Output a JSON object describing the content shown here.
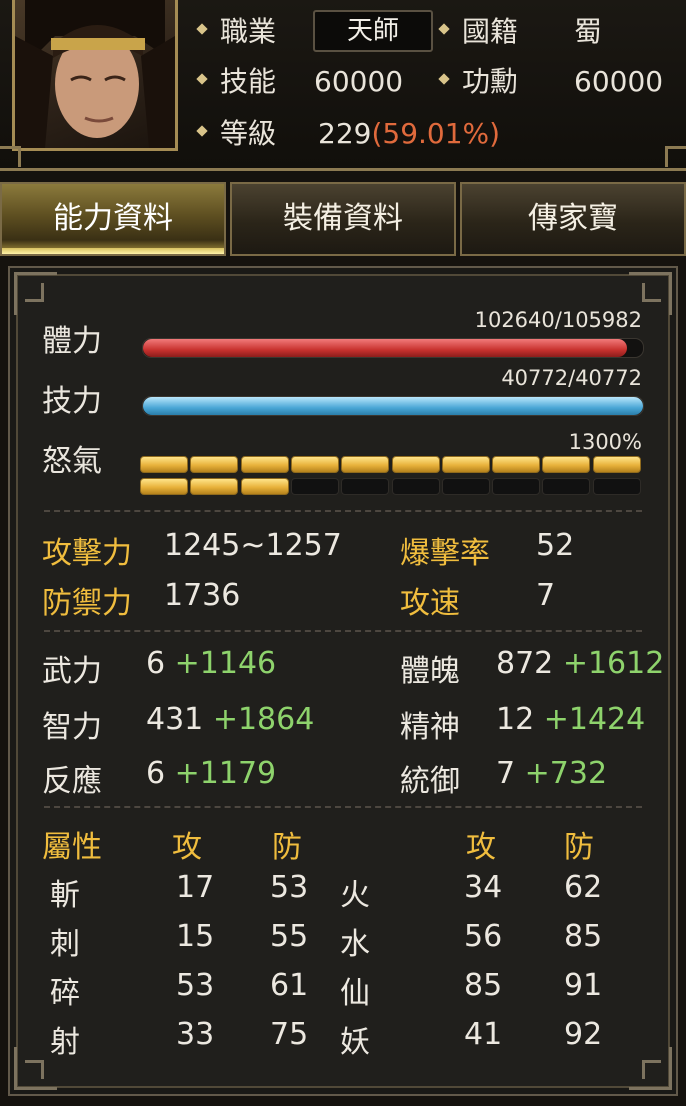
{
  "header": {
    "class_label": "職業",
    "class_value": "天師",
    "nation_label": "國籍",
    "nation_value": "蜀",
    "skill_label": "技能",
    "skill_value": "60000",
    "merit_label": "功勳",
    "merit_value": "60000",
    "level_label": "等級",
    "level_value": "229",
    "level_pct": "(59.01%)"
  },
  "tabs": [
    "能力資料",
    "裝備資料",
    "傳家寶"
  ],
  "active_tab": 0,
  "vitals": {
    "hp_label": "體力",
    "hp_text": "102640/105982",
    "hp_fraction": 0.9685,
    "mp_label": "技力",
    "mp_text": "40772/40772",
    "mp_fraction": 1.0,
    "rage_label": "怒氣",
    "rage_text": "1300%",
    "rage_filled": 13,
    "rage_total": 20
  },
  "combat": {
    "atk_label": "攻擊力",
    "atk_value": "1245~1257",
    "crit_label": "爆擊率",
    "crit_value": "52",
    "def_label": "防禦力",
    "def_value": "1736",
    "speed_label": "攻速",
    "speed_value": "7"
  },
  "attributes": [
    {
      "label": "武力",
      "base": "6",
      "bonus": "+1146"
    },
    {
      "label": "體魄",
      "base": "872",
      "bonus": "+1612"
    },
    {
      "label": "智力",
      "base": "431",
      "bonus": "+1864"
    },
    {
      "label": "精神",
      "base": "12",
      "bonus": "+1424"
    },
    {
      "label": "反應",
      "base": "6",
      "bonus": "+1179"
    },
    {
      "label": "統御",
      "base": "7",
      "bonus": "+732"
    }
  ],
  "elements": {
    "header": {
      "title": "屬性",
      "atk": "攻",
      "def": "防",
      "atk2": "攻",
      "def2": "防"
    },
    "rows": [
      {
        "a": "斬",
        "a_atk": "17",
        "a_def": "53",
        "b": "火",
        "b_atk": "34",
        "b_def": "62"
      },
      {
        "a": "刺",
        "a_atk": "15",
        "a_def": "55",
        "b": "水",
        "b_atk": "56",
        "b_def": "85"
      },
      {
        "a": "碎",
        "a_atk": "53",
        "a_def": "61",
        "b": "仙",
        "b_atk": "85",
        "b_def": "91"
      },
      {
        "a": "射",
        "a_atk": "33",
        "a_def": "75",
        "b": "妖",
        "b_atk": "41",
        "b_def": "92"
      }
    ]
  },
  "colors": {
    "gold": "#f0bd3e",
    "bonus_green": "#8ed36c",
    "level_pct": "#e06a3c",
    "hp": "#c8322f",
    "mp": "#4aa7d6"
  }
}
